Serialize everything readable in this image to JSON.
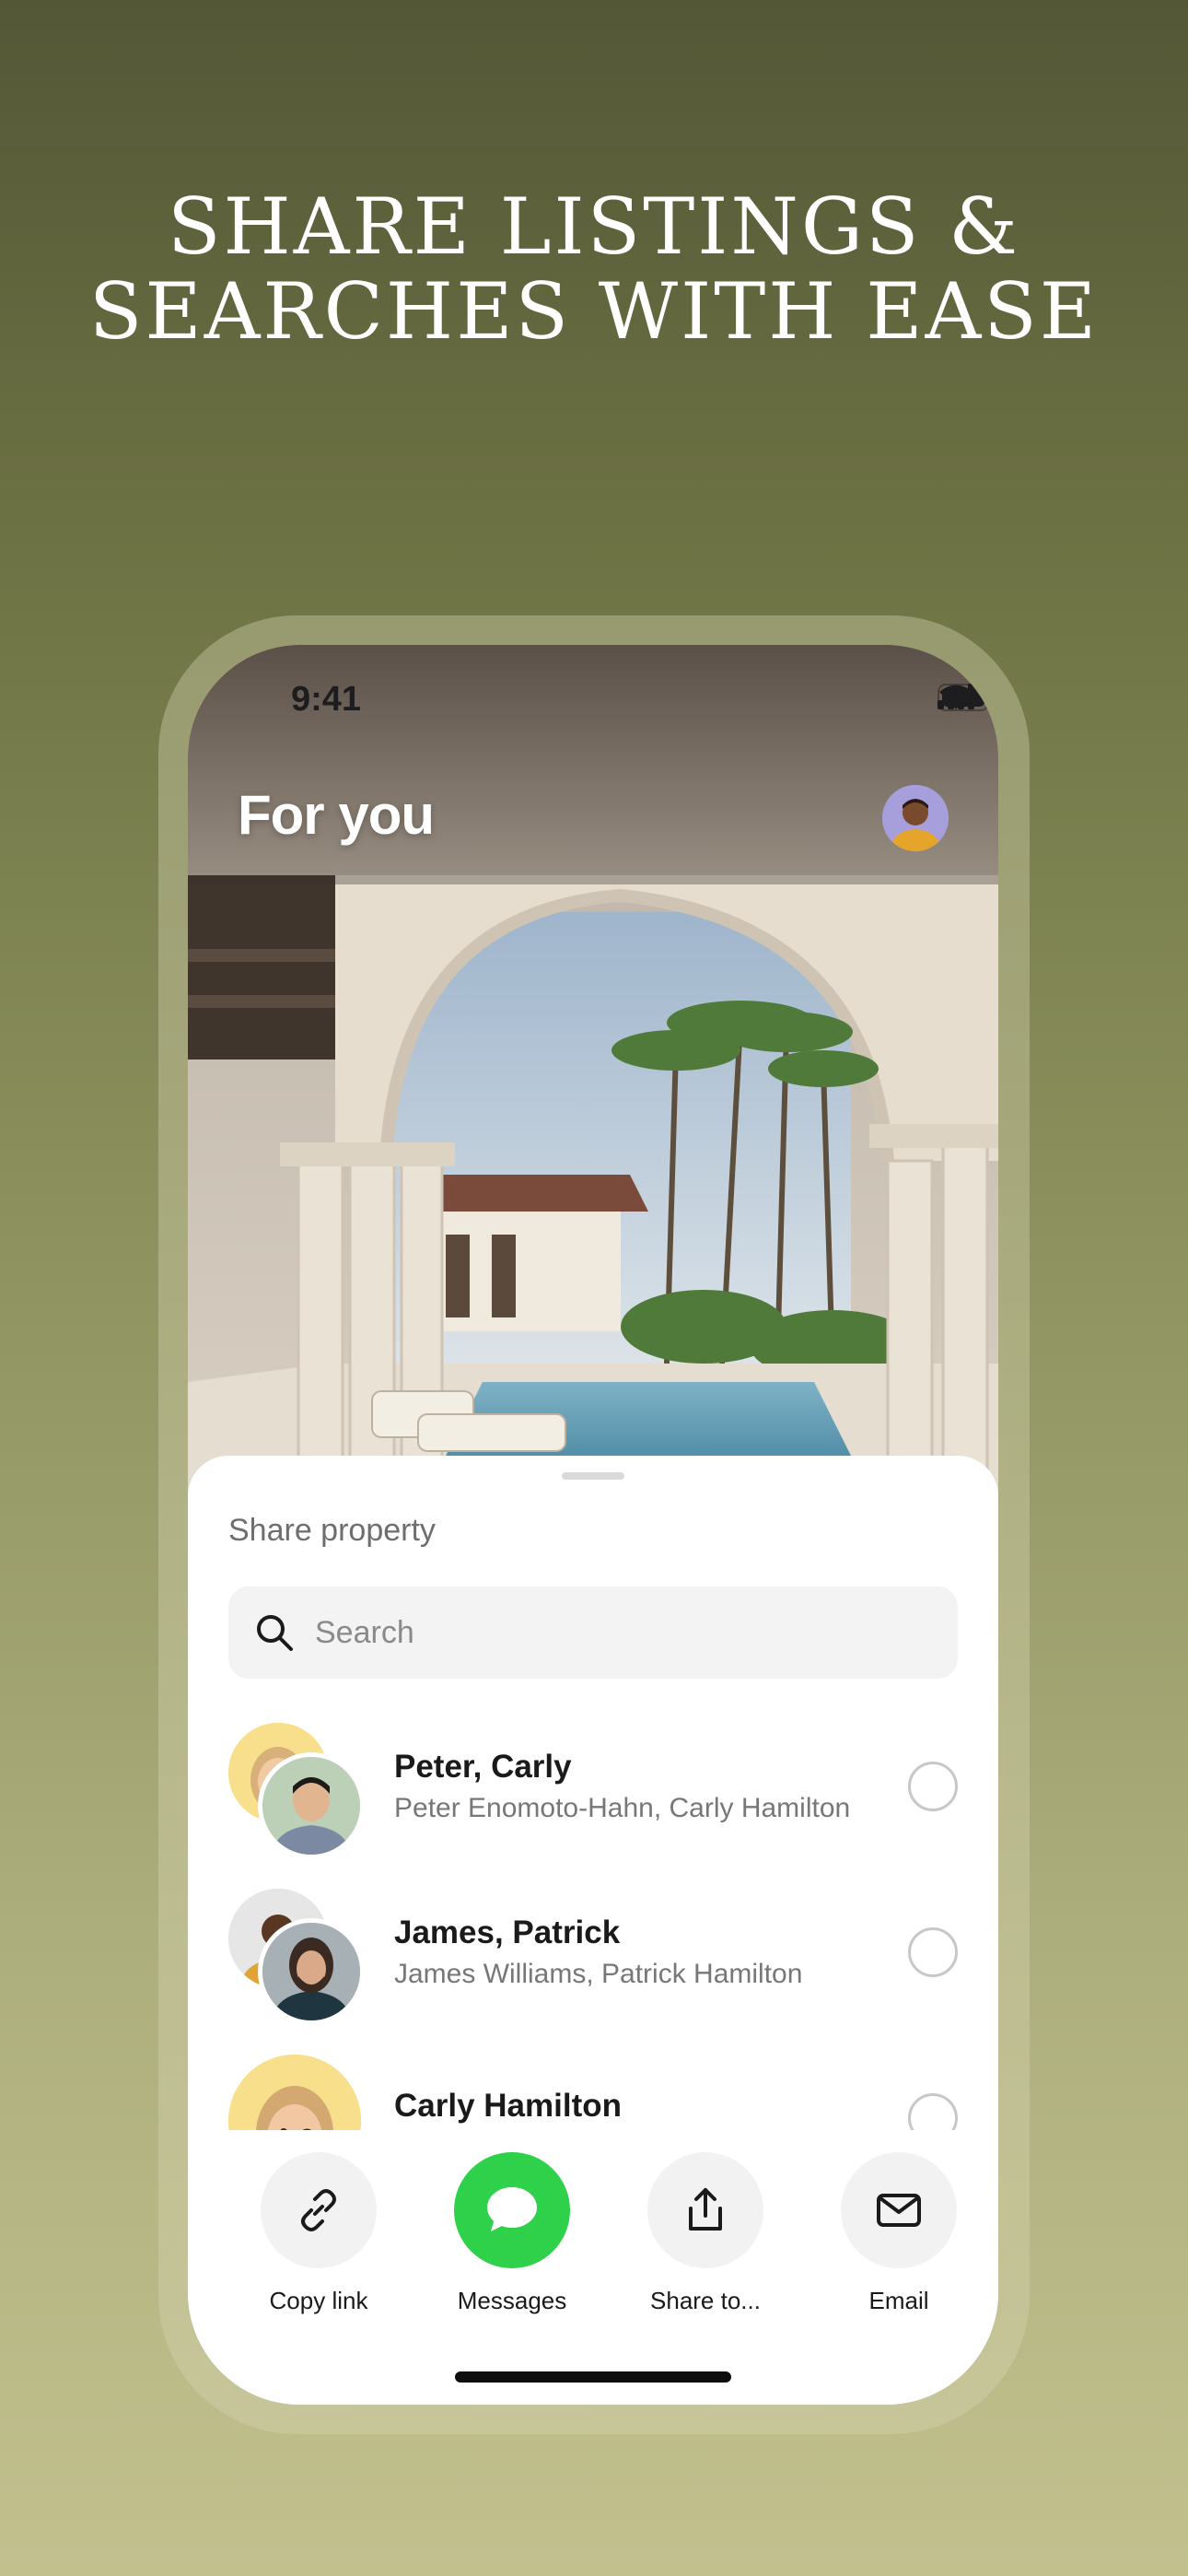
{
  "headline": {
    "line1": "SHARE LISTINGS &",
    "line2": "SEARCHES WITH EASE"
  },
  "status_bar": {
    "time": "9:41",
    "icons": [
      "signal-icon",
      "wifi-icon",
      "battery-icon"
    ]
  },
  "screen": {
    "title": "For you"
  },
  "sheet": {
    "title": "Share property",
    "search": {
      "placeholder": "Search",
      "value": ""
    },
    "contacts": [
      {
        "name": "Peter, Carly",
        "members": "Peter Enomoto-Hahn, Carly Hamilton"
      },
      {
        "name": "James, Patrick",
        "members": "James Williams, Patrick Hamilton"
      },
      {
        "name": "Carly Hamilton",
        "members": ""
      }
    ],
    "actions": [
      {
        "label": "Copy link",
        "icon": "link-icon"
      },
      {
        "label": "Messages",
        "icon": "messages-icon"
      },
      {
        "label": "Share to...",
        "icon": "share-icon"
      },
      {
        "label": "Email",
        "icon": "email-icon"
      }
    ]
  },
  "colors": {
    "messages_green": "#2fd04a",
    "background_top": "#545736",
    "background_bottom": "#c2c18e"
  }
}
